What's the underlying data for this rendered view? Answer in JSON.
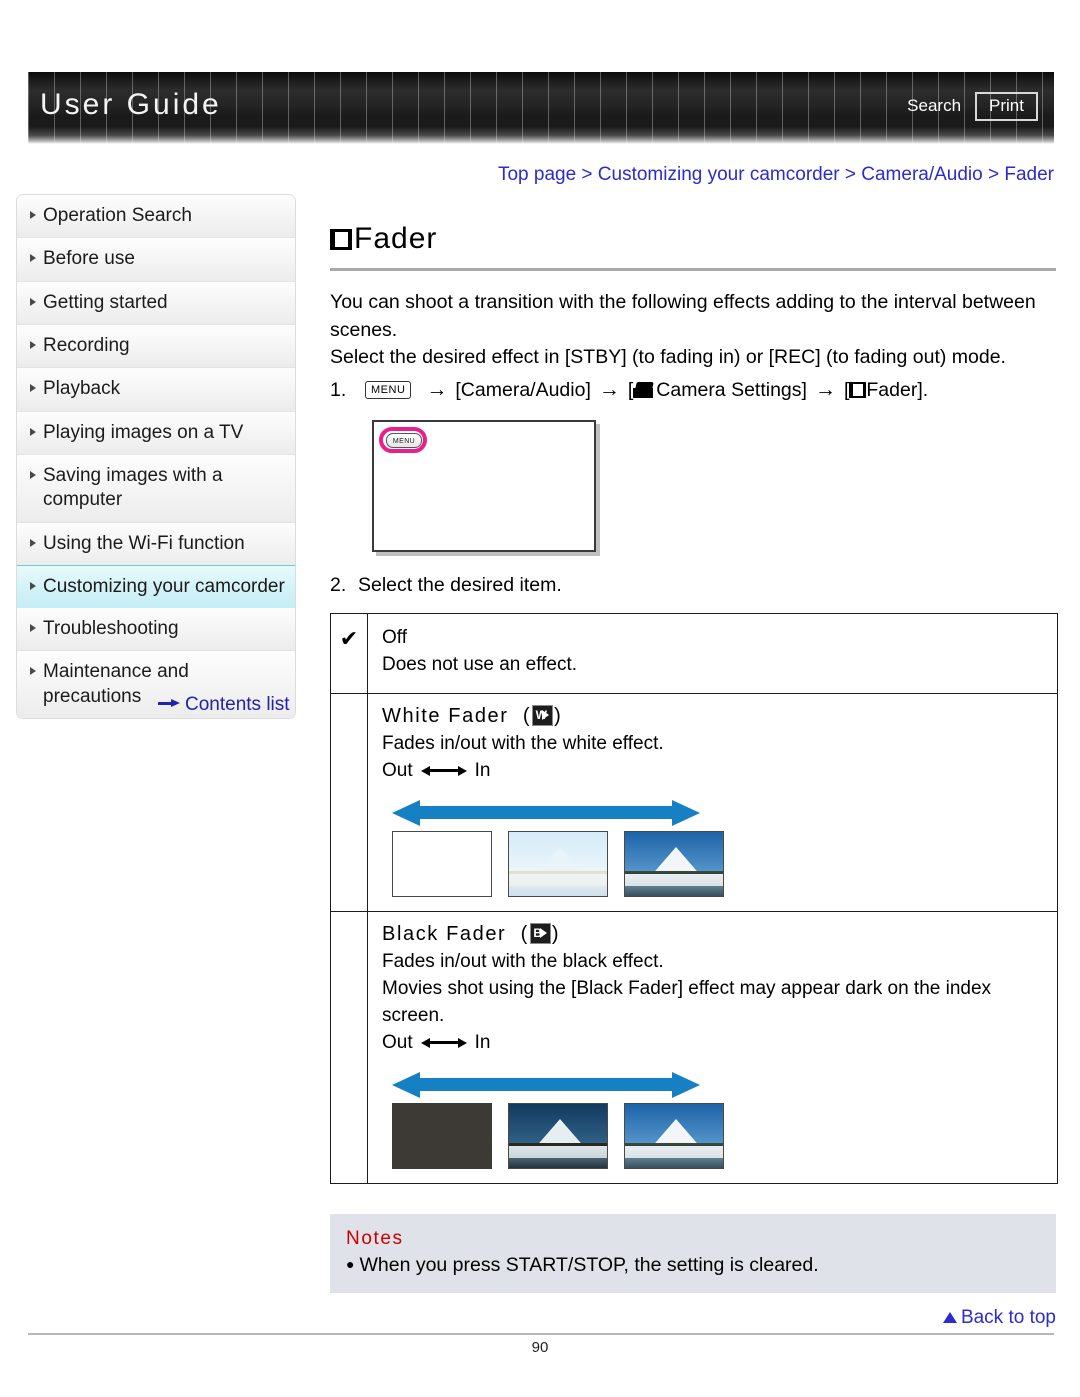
{
  "header": {
    "title": "User Guide",
    "search_label": "Search",
    "print_label": "Print"
  },
  "breadcrumb": {
    "text": "Top page > Customizing your camcorder > Camera/Audio > Fader"
  },
  "sidebar": {
    "items": [
      {
        "label": "Operation Search",
        "active": false
      },
      {
        "label": "Before use",
        "active": false
      },
      {
        "label": "Getting started",
        "active": false
      },
      {
        "label": "Recording",
        "active": false
      },
      {
        "label": "Playback",
        "active": false
      },
      {
        "label": "Playing images on a TV",
        "active": false
      },
      {
        "label": "Saving images with a computer",
        "active": false
      },
      {
        "label": "Using the Wi-Fi function",
        "active": false
      },
      {
        "label": "Customizing your camcorder",
        "active": true
      },
      {
        "label": "Troubleshooting",
        "active": false
      },
      {
        "label": "Maintenance and precautions",
        "active": false
      }
    ],
    "contents_list_label": "Contents list",
    "highlight_color": "#c4eef5",
    "highlight_border": "#66ccdd"
  },
  "main": {
    "page_title": "Fader",
    "intro_line1": "You can shoot a transition with the following effects adding to the interval between scenes.",
    "intro_line2": "Select the desired effect in [STBY] (to fading in) or [REC] (to fading out) mode.",
    "step1": {
      "number": "1.",
      "menu_chip": "MENU",
      "arrow": "→",
      "part1": "[Camera/Audio]",
      "part2_label": "Camera Settings]",
      "part2_open": "[",
      "part3_open": "[",
      "part3_label": "Fader]."
    },
    "diagram": {
      "menu_button_label": "MENU",
      "highlight_color": "#ea1e8c"
    },
    "step2": {
      "number": "2.",
      "text": "Select the desired item."
    },
    "options": [
      {
        "checked": true,
        "check_glyph": "✔",
        "name": "Off",
        "desc": "Does not use an effect.",
        "has_icon": false,
        "icon_letter": "",
        "lines": [],
        "has_inout": false,
        "has_sequence": false,
        "first_thumb": ""
      },
      {
        "checked": false,
        "check_glyph": "",
        "name": "White Fader",
        "icon_letter": "W",
        "has_icon": true,
        "lines": [
          "Fades in/out with the white effect."
        ],
        "has_inout": true,
        "out_label": "Out",
        "in_label": "In",
        "has_sequence": true,
        "first_thumb": "white"
      },
      {
        "checked": false,
        "check_glyph": "",
        "name": "Black Fader",
        "icon_letter": "B",
        "has_icon": true,
        "lines": [
          "Fades in/out with the black effect.",
          "Movies shot using the [Black Fader] effect may appear dark on the index screen."
        ],
        "has_inout": true,
        "out_label": "Out",
        "in_label": "In",
        "has_sequence": true,
        "first_thumb": "black"
      }
    ],
    "notes": {
      "title": "Notes",
      "bullet": "●",
      "items": [
        "When you press START/STOP, the setting is cleared."
      ],
      "title_color": "#cc0000",
      "background": "#dfe3e9"
    },
    "back_to_top": "Back to top",
    "accent_blue": "#1580c4"
  },
  "footer": {
    "page_number": "90"
  }
}
